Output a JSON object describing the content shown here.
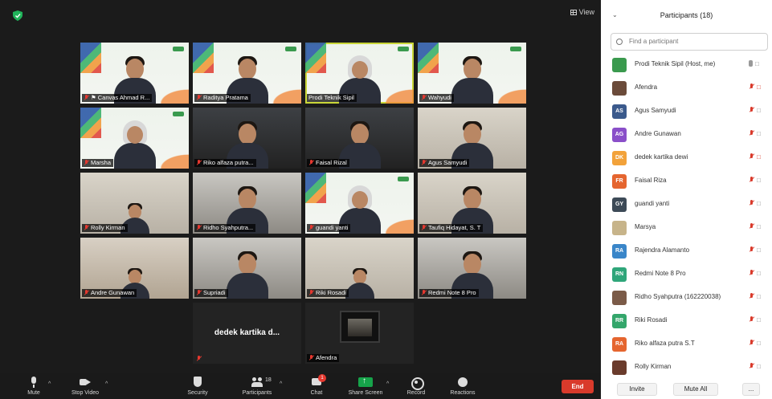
{
  "meeting": {
    "view_label": "View",
    "tiles": [
      {
        "name": "Canvas Ahmad R...",
        "style": "banner",
        "person": true,
        "muted": true,
        "pin": true
      },
      {
        "name": "Raditya Pratama",
        "style": "banner",
        "person": true,
        "muted": true
      },
      {
        "name": "Prodi Teknik Sipil",
        "style": "banner",
        "person": "hijab",
        "muted": false,
        "active": true
      },
      {
        "name": "Wahyudi",
        "style": "banner",
        "person": true,
        "muted": true
      },
      {
        "name": "Marsha",
        "style": "banner",
        "person": "hijab",
        "muted": true
      },
      {
        "name": "Riko alfaza putra...",
        "style": "dark",
        "person": true,
        "muted": true
      },
      {
        "name": "Faisal Rizal",
        "style": "dark",
        "person": true,
        "muted": true
      },
      {
        "name": "Agus Samyudi",
        "style": "room",
        "person": true,
        "muted": true
      },
      {
        "name": "Rolly Kirman",
        "style": "room",
        "person": "small",
        "muted": true
      },
      {
        "name": "Ridho Syahputra...",
        "style": "room2",
        "person": true,
        "muted": true
      },
      {
        "name": "guandi yanti",
        "style": "banner",
        "person": "hijab",
        "muted": true
      },
      {
        "name": "Taufiq Hidayat, S. T",
        "style": "room",
        "person": true,
        "muted": true
      },
      {
        "name": "Andre Gunawan",
        "style": "room3",
        "person": "small",
        "muted": true
      },
      {
        "name": "Supriadi",
        "style": "room2",
        "person": true,
        "muted": true
      },
      {
        "name": "Riki Rosadi",
        "style": "room",
        "person": "small",
        "muted": true
      },
      {
        "name": "Redmi Note 8 Pro",
        "style": "room2",
        "person": true,
        "muted": true
      },
      {
        "name": "",
        "style": "plain",
        "center_text": "dedek kartika d...",
        "muted": true
      },
      {
        "name": "Afendra",
        "style": "plain",
        "thumb": true,
        "muted": true
      }
    ]
  },
  "toolbar": {
    "mute": "Mute",
    "stop_video": "Stop Video",
    "security": "Security",
    "participants": "Participants",
    "participants_count": "18",
    "chat": "Chat",
    "chat_badge": "1",
    "share_screen": "Share Screen",
    "record": "Record",
    "reactions": "Reactions",
    "end": "End"
  },
  "panel": {
    "title": "Participants (18)",
    "search_placeholder": "Find a participant",
    "participants": [
      {
        "name": "Prodi Teknik Sipil (Host, me)",
        "avatar": "photo",
        "color": "#3a9a4e",
        "mic": "on",
        "video": "on"
      },
      {
        "name": "Afendra",
        "avatar": "photo",
        "color": "#6b4b3a",
        "mic": "off",
        "video": "off"
      },
      {
        "name": "Agus Samyudi",
        "initials": "AS",
        "color": "#3b5a8c",
        "mic": "off",
        "video": "on"
      },
      {
        "name": "Andre Gunawan",
        "initials": "AG",
        "color": "#8a4fc9",
        "mic": "off",
        "video": "on"
      },
      {
        "name": "dedek kartika dewi",
        "initials": "DK",
        "color": "#f2a23a",
        "mic": "off",
        "video": "off"
      },
      {
        "name": "Faisal Riza",
        "initials": "FR",
        "color": "#e5652f",
        "mic": "off",
        "video": "on"
      },
      {
        "name": "guandi yanti",
        "initials": "GY",
        "color": "#3d4a57",
        "mic": "off",
        "video": "on"
      },
      {
        "name": "Marsya",
        "avatar": "photo",
        "color": "#c7b48a",
        "mic": "off",
        "video": "on"
      },
      {
        "name": "Rajendra Alamanto",
        "initials": "RA",
        "color": "#3a86c9",
        "mic": "off",
        "video": "on"
      },
      {
        "name": "Redmi Note 8 Pro",
        "initials": "RN",
        "color": "#2fa67a",
        "mic": "off",
        "video": "on"
      },
      {
        "name": "Ridho Syahputra (162220038)",
        "avatar": "photo",
        "color": "#7b5b48",
        "mic": "off",
        "video": "on"
      },
      {
        "name": "Riki Rosadi",
        "initials": "RR",
        "color": "#34a66b",
        "mic": "off",
        "video": "on"
      },
      {
        "name": "Riko alfaza putra S.T",
        "initials": "RA",
        "color": "#e5652f",
        "mic": "off",
        "video": "on"
      },
      {
        "name": "Rolly Kirman",
        "avatar": "photo",
        "color": "#6a3b2c",
        "mic": "off",
        "video": "on"
      }
    ],
    "invite": "Invite",
    "mute_all": "Mute All",
    "more": "..."
  }
}
